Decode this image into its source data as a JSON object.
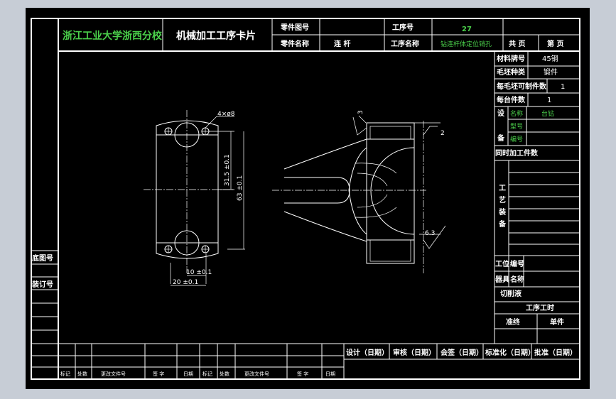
{
  "header": {
    "school": "浙江工业大学浙西分校",
    "card_title": "机械加工工序卡片",
    "part_no_label": "零件图号",
    "part_no_value": "",
    "part_name_label": "零件名称",
    "part_name_value": "连  杆",
    "process_no_label": "工序号",
    "process_no_value": "27",
    "process_name_label": "工序名称",
    "process_name_value": "钻连杆体定位销孔",
    "total_pages_label": "共  页",
    "page_label": "第  页"
  },
  "right_panel": {
    "material_label": "材料牌号",
    "material_value": "45钢",
    "blank_type_label": "毛坯种类",
    "blank_type_value": "锻件",
    "parts_per_blank_label": "每毛坯可制件数",
    "parts_per_blank_value": "1",
    "parts_per_unit_label": "每台件数",
    "parts_per_unit_value": "1",
    "equipment_label": "设 备",
    "equip_name_label": "名称",
    "equip_name_value": "台钻",
    "equip_model_label": "型号",
    "equip_number_label": "编号",
    "simultaneous_label": "同时加工件数",
    "process_equipment_label": "工 艺 装 备",
    "fixture_label": "工位",
    "fixture_no_label": "编号",
    "tool_label": "器具",
    "tool_name_label": "名称",
    "coolant_label": "切削液",
    "process_time_label": "工序工时",
    "prep_time_label": "准终",
    "unit_time_label": "单件"
  },
  "left_strip": {
    "base_drawing_label": "底图号",
    "binding_no_label": "装订号"
  },
  "bottom": {
    "design_label": "设计（日期）",
    "review_label": "审核（日期）",
    "countersign_label": "会签（日期）",
    "standardize_label": "标准化（日期）",
    "approve_label": "批准（日期）",
    "rev_cols": [
      "标记",
      "处数",
      "更改文件号",
      "签 字",
      "日期",
      "标记",
      "处数",
      "更改文件号",
      "签 字",
      "日期"
    ]
  },
  "drawing": {
    "hole_callout": "4×ø8",
    "dim_31_5": "31.5 ±0.1",
    "dim_63": "63 ±0.1",
    "dim_10": "10 ±0.1",
    "dim_20": "20 ±0.1",
    "roughness_top": "3",
    "roughness_right": "2",
    "roughness_bottom": "6.3"
  },
  "colors": {
    "background": "#c7cdd6",
    "sheet": "#000000",
    "line": "#ffffff",
    "accent_text": "#4bd14b"
  }
}
